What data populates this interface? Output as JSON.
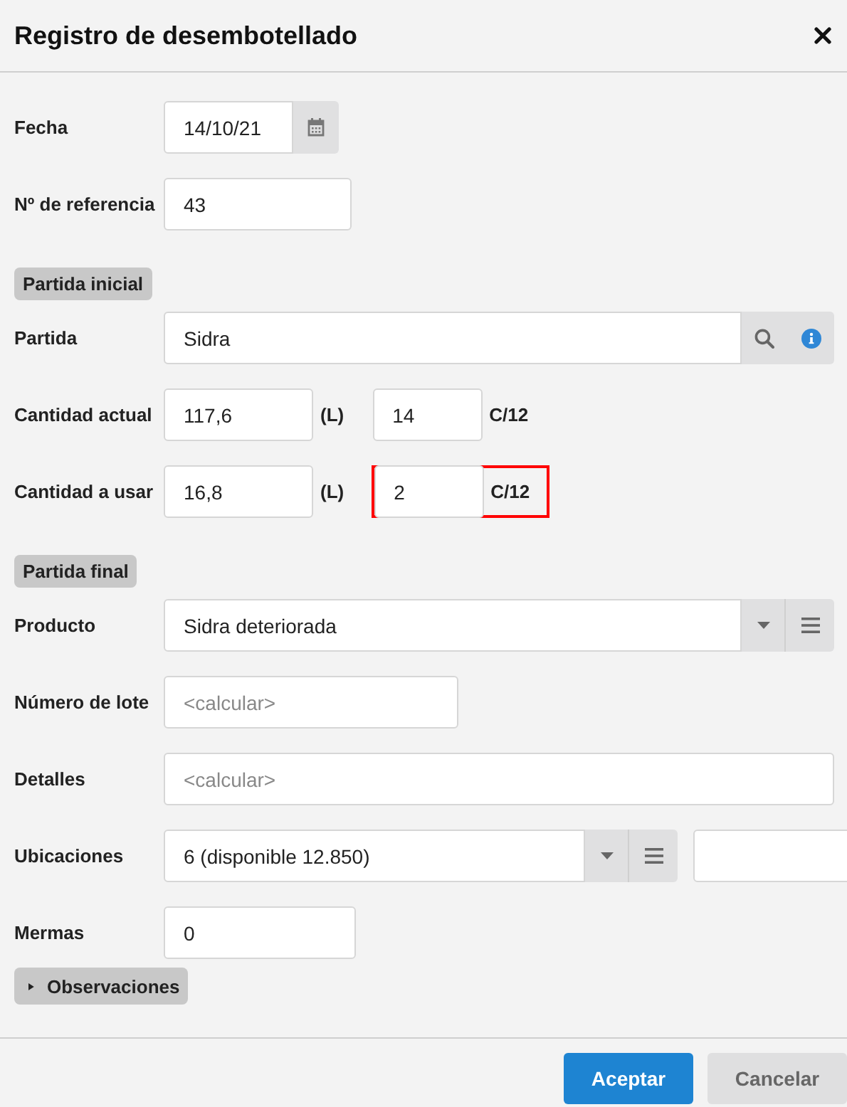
{
  "dialog": {
    "title": "Registro de desembotellado"
  },
  "rows": [
    {
      "kind": "date",
      "label": "Fecha",
      "value": "14/10/21"
    },
    {
      "kind": "text",
      "label": "Nº de referencia",
      "value": "43"
    },
    {
      "kind": "section",
      "label": "Partida inicial"
    },
    {
      "kind": "lookup",
      "label": "Partida",
      "value": "Sidra"
    },
    {
      "kind": "quantity",
      "label": "Cantidad actual",
      "liters": "117,6",
      "liters_unit": "(L)",
      "cases": "14",
      "cases_unit": "C/12",
      "highlighted": false
    },
    {
      "kind": "quantity",
      "label": "Cantidad a usar",
      "liters": "16,8",
      "liters_unit": "(L)",
      "cases": "2",
      "cases_unit": "C/12",
      "highlighted": true
    },
    {
      "kind": "section",
      "label": "Partida final"
    },
    {
      "kind": "select",
      "label": "Producto",
      "value": "Sidra deteriorada"
    },
    {
      "kind": "text",
      "label": "Número de lote",
      "placeholder": "<calcular>"
    },
    {
      "kind": "wide",
      "label": "Detalles",
      "placeholder": "<calcular>"
    },
    {
      "kind": "select_pair",
      "label": "Ubicaciones",
      "value": "6 (disponible 12.850)"
    },
    {
      "kind": "text",
      "label": "Mermas",
      "value": "0"
    },
    {
      "kind": "collapsible",
      "label": "Observaciones",
      "expanded": false
    }
  ],
  "buttons": [
    {
      "label": "Aceptar",
      "primary": true
    },
    {
      "label": "Cancelar",
      "primary": false
    }
  ]
}
